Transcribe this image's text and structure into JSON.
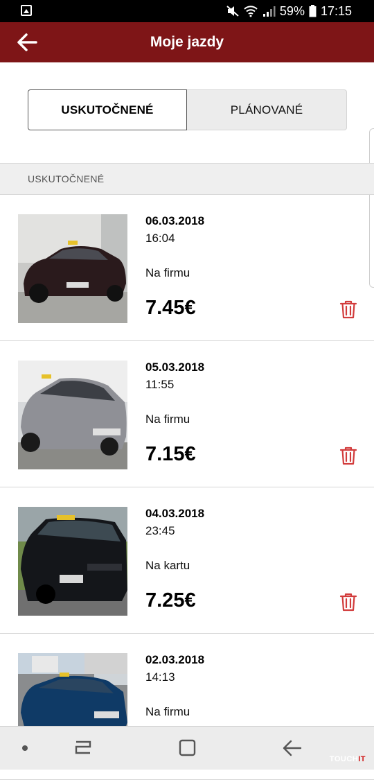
{
  "status_bar": {
    "battery": "59%",
    "time": "17:15",
    "icons": [
      "image-icon",
      "mute-icon",
      "wifi-icon",
      "signal-icon",
      "battery-icon"
    ]
  },
  "app_bar": {
    "title": "Moje jazdy",
    "back_icon": "back-arrow-icon",
    "color": "#7e1517"
  },
  "tabs": [
    {
      "label": "USKUTOČNENÉ",
      "active": true
    },
    {
      "label": "PLÁNOVANÉ",
      "active": false
    }
  ],
  "section": {
    "header": "USKUTOČNENÉ"
  },
  "rides": [
    {
      "date": "06.03.2018",
      "time": "16:04",
      "payment": "Na firmu",
      "price": "7.45€",
      "car_color": "#2a1a1c"
    },
    {
      "date": "05.03.2018",
      "time": "11:55",
      "payment": "Na firmu",
      "price": "7.15€",
      "car_color": "#8f9096"
    },
    {
      "date": "04.03.2018",
      "time": "23:45",
      "payment": "Na kartu",
      "price": "7.25€",
      "car_color": "#14161a"
    },
    {
      "date": "02.03.2018",
      "time": "14:13",
      "payment": "Na firmu",
      "price": "",
      "car_color": "#0f3a66"
    }
  ],
  "delete_icon_color": "#d23c3c",
  "nav_bar": {
    "items": [
      "dot-icon",
      "recent-apps-icon",
      "home-icon",
      "back-icon"
    ]
  },
  "watermark": {
    "part1": "TOUCH",
    "part2": "IT"
  }
}
